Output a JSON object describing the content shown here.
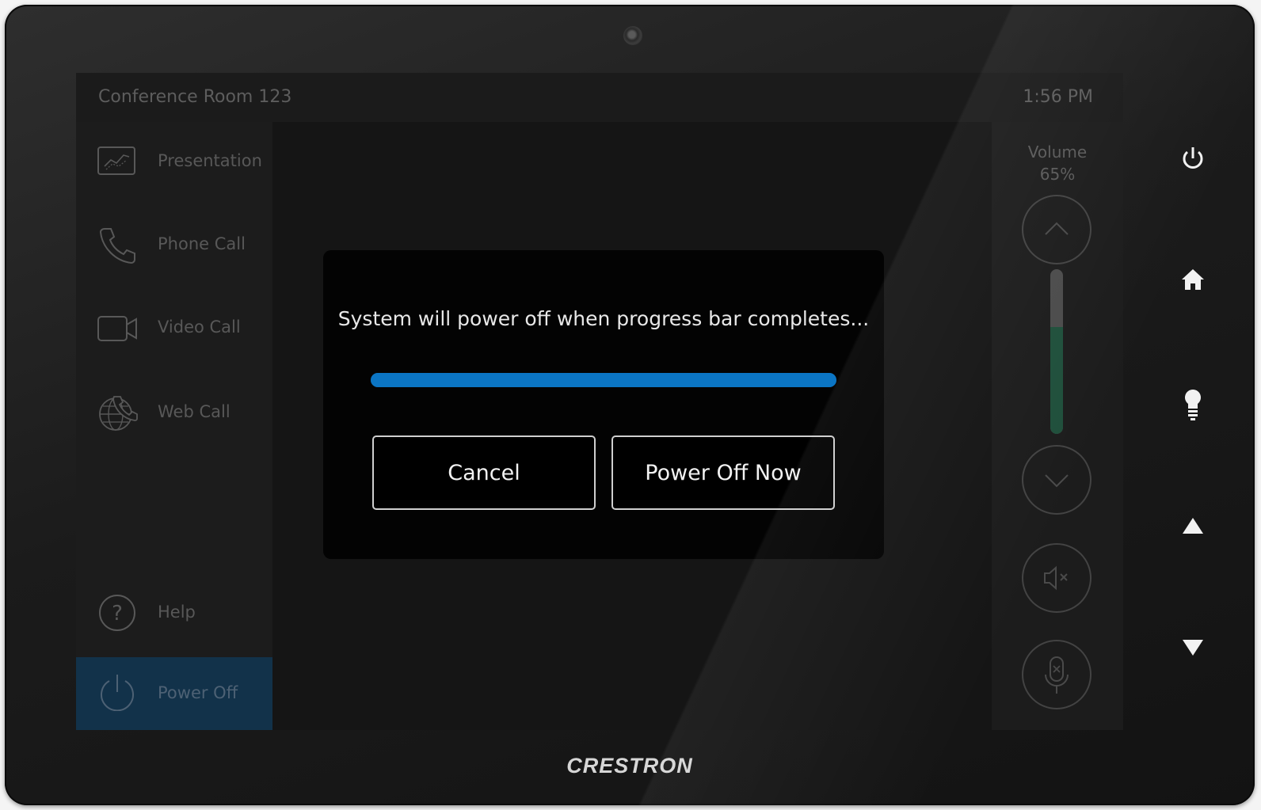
{
  "device": {
    "brand": "CRESTRON"
  },
  "header": {
    "room_name": "Conference Room 123",
    "time": "1:56 PM"
  },
  "nav": {
    "items": [
      {
        "label": "Presentation",
        "icon": "presentation-chart-icon"
      },
      {
        "label": "Phone Call",
        "icon": "phone-icon"
      },
      {
        "label": "Video Call",
        "icon": "video-camera-icon"
      },
      {
        "label": "Web Call",
        "icon": "globe-phone-icon"
      }
    ],
    "help": {
      "label": "Help",
      "icon": "help-icon"
    },
    "power": {
      "label": "Power Off",
      "icon": "power-icon",
      "active": true
    }
  },
  "volume": {
    "title": "Volume",
    "value_text": "65%",
    "level": 0.65,
    "fill_color": "#1f4f3b"
  },
  "dialog": {
    "message": "System will power off when progress bar completes...",
    "progress": 1.0,
    "progress_color": "#0b75c4",
    "cancel_label": "Cancel",
    "confirm_label": "Power Off Now"
  },
  "hard_keys": [
    "power-icon",
    "home-icon",
    "light-bulb-icon",
    "up-arrow-icon",
    "down-arrow-icon"
  ]
}
